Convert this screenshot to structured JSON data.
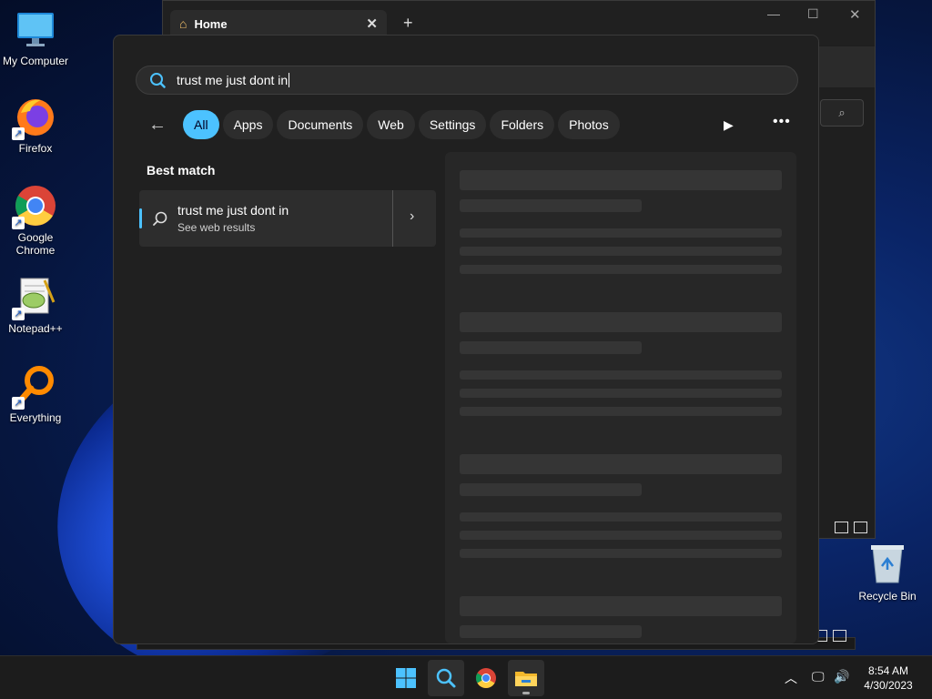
{
  "desktop": {
    "icons": [
      {
        "label": "My Computer"
      },
      {
        "label": "Firefox"
      },
      {
        "label": "Google Chrome"
      },
      {
        "label": "Notepad++"
      },
      {
        "label": "Everything"
      }
    ],
    "recycle_bin": "Recycle Bin"
  },
  "explorer": {
    "tab_title": "Home",
    "close_glyph": "✕",
    "new_tab_glyph": "+"
  },
  "search": {
    "query": "trust me just dont in",
    "filters": [
      "All",
      "Apps",
      "Documents",
      "Web",
      "Settings",
      "Folders",
      "Photos"
    ],
    "active_filter": "All",
    "best_match_label": "Best match",
    "result": {
      "title": "trust me just dont in",
      "subtitle": "See web results"
    }
  },
  "taskbar": {
    "apps": [
      "start-icon",
      "search-icon",
      "chrome-icon",
      "file-explorer-icon"
    ],
    "clock": {
      "time": "8:54 AM",
      "date": "4/30/2023"
    }
  },
  "colors": {
    "accent": "#4cc2ff",
    "panel": "#202020",
    "skeleton": "#353535"
  }
}
